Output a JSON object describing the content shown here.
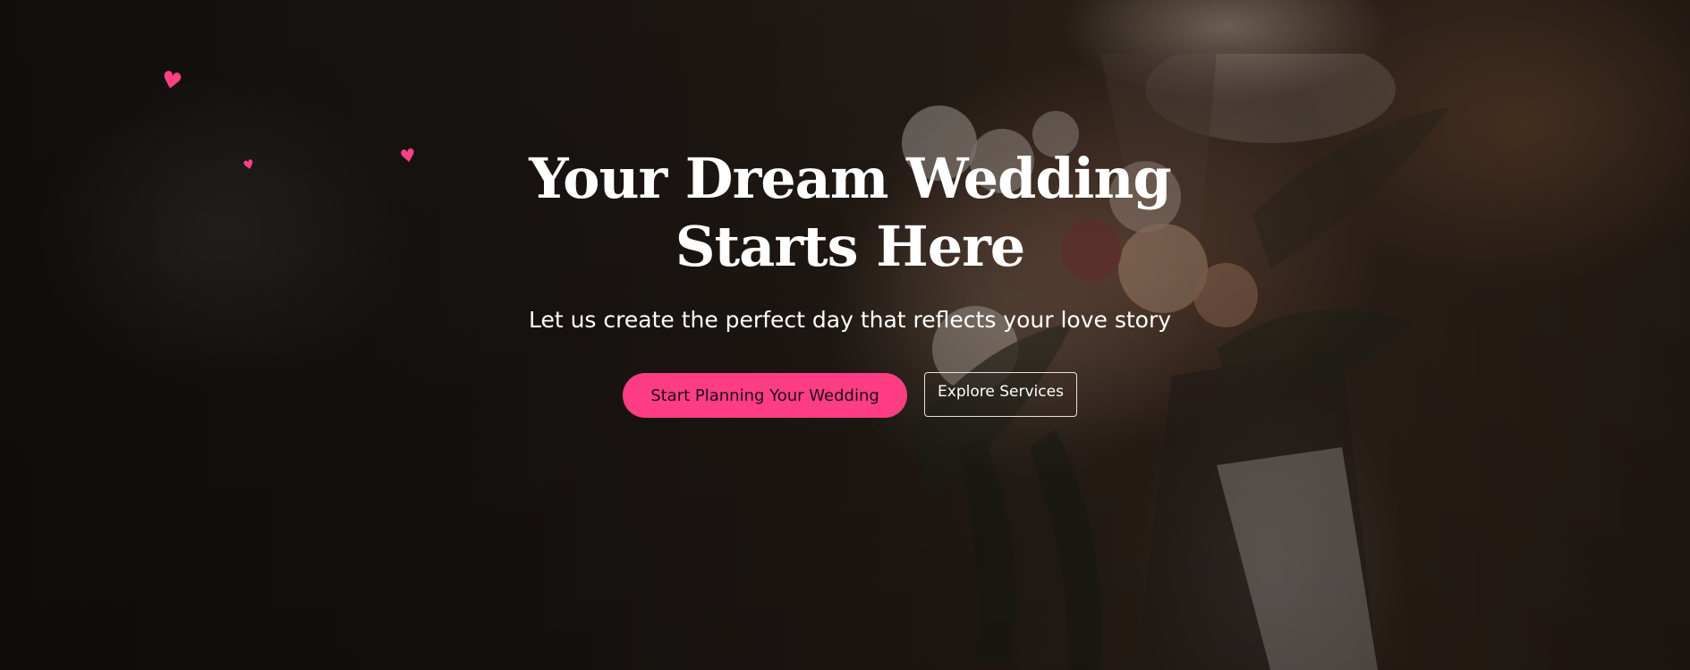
{
  "hero": {
    "title": "Your Dream Wedding Starts Here",
    "subtitle": "Let us create the perfect day that reflects your love story",
    "primary_button": "Start Planning Your Wedding",
    "secondary_button": "Explore Services",
    "background_image": "bride-holding-bouquet-photo",
    "decorations": [
      "heart-icon",
      "heart-icon",
      "heart-icon"
    ]
  },
  "colors": {
    "accent": "#ff3d84",
    "text": "#ffffff",
    "overlay": "#1a1512"
  }
}
